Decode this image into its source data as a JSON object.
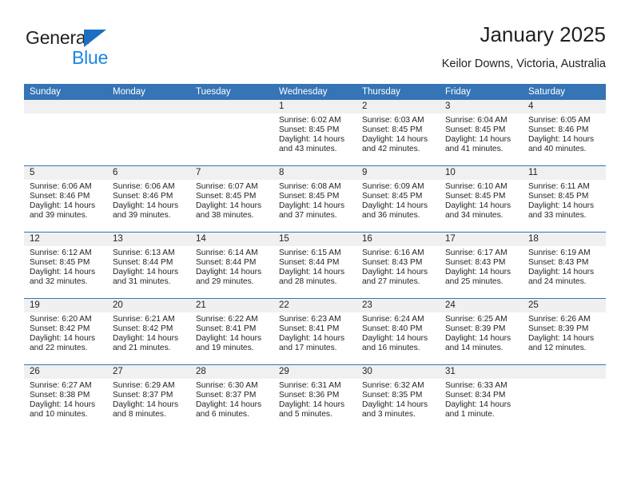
{
  "brand": {
    "name_part1": "General",
    "name_part2": "Blue",
    "triangle_color": "#1b6fc1",
    "blue_text_color": "#1b86e0"
  },
  "header": {
    "title": "January 2025",
    "subtitle": "Keilor Downs, Victoria, Australia",
    "header_bg_color": "#3574b5",
    "daynum_band_color": "#f0f0f0"
  },
  "weekday_headers": [
    "Sunday",
    "Monday",
    "Tuesday",
    "Wednesday",
    "Thursday",
    "Friday",
    "Saturday"
  ],
  "weeks": [
    [
      {
        "day": "",
        "sunrise": "",
        "sunset": "",
        "daylight_line1": "",
        "daylight_line2": ""
      },
      {
        "day": "",
        "sunrise": "",
        "sunset": "",
        "daylight_line1": "",
        "daylight_line2": ""
      },
      {
        "day": "",
        "sunrise": "",
        "sunset": "",
        "daylight_line1": "",
        "daylight_line2": ""
      },
      {
        "day": "1",
        "sunrise": "Sunrise: 6:02 AM",
        "sunset": "Sunset: 8:45 PM",
        "daylight_line1": "Daylight: 14 hours",
        "daylight_line2": "and 43 minutes."
      },
      {
        "day": "2",
        "sunrise": "Sunrise: 6:03 AM",
        "sunset": "Sunset: 8:45 PM",
        "daylight_line1": "Daylight: 14 hours",
        "daylight_line2": "and 42 minutes."
      },
      {
        "day": "3",
        "sunrise": "Sunrise: 6:04 AM",
        "sunset": "Sunset: 8:45 PM",
        "daylight_line1": "Daylight: 14 hours",
        "daylight_line2": "and 41 minutes."
      },
      {
        "day": "4",
        "sunrise": "Sunrise: 6:05 AM",
        "sunset": "Sunset: 8:46 PM",
        "daylight_line1": "Daylight: 14 hours",
        "daylight_line2": "and 40 minutes."
      }
    ],
    [
      {
        "day": "5",
        "sunrise": "Sunrise: 6:06 AM",
        "sunset": "Sunset: 8:46 PM",
        "daylight_line1": "Daylight: 14 hours",
        "daylight_line2": "and 39 minutes."
      },
      {
        "day": "6",
        "sunrise": "Sunrise: 6:06 AM",
        "sunset": "Sunset: 8:46 PM",
        "daylight_line1": "Daylight: 14 hours",
        "daylight_line2": "and 39 minutes."
      },
      {
        "day": "7",
        "sunrise": "Sunrise: 6:07 AM",
        "sunset": "Sunset: 8:45 PM",
        "daylight_line1": "Daylight: 14 hours",
        "daylight_line2": "and 38 minutes."
      },
      {
        "day": "8",
        "sunrise": "Sunrise: 6:08 AM",
        "sunset": "Sunset: 8:45 PM",
        "daylight_line1": "Daylight: 14 hours",
        "daylight_line2": "and 37 minutes."
      },
      {
        "day": "9",
        "sunrise": "Sunrise: 6:09 AM",
        "sunset": "Sunset: 8:45 PM",
        "daylight_line1": "Daylight: 14 hours",
        "daylight_line2": "and 36 minutes."
      },
      {
        "day": "10",
        "sunrise": "Sunrise: 6:10 AM",
        "sunset": "Sunset: 8:45 PM",
        "daylight_line1": "Daylight: 14 hours",
        "daylight_line2": "and 34 minutes."
      },
      {
        "day": "11",
        "sunrise": "Sunrise: 6:11 AM",
        "sunset": "Sunset: 8:45 PM",
        "daylight_line1": "Daylight: 14 hours",
        "daylight_line2": "and 33 minutes."
      }
    ],
    [
      {
        "day": "12",
        "sunrise": "Sunrise: 6:12 AM",
        "sunset": "Sunset: 8:45 PM",
        "daylight_line1": "Daylight: 14 hours",
        "daylight_line2": "and 32 minutes."
      },
      {
        "day": "13",
        "sunrise": "Sunrise: 6:13 AM",
        "sunset": "Sunset: 8:44 PM",
        "daylight_line1": "Daylight: 14 hours",
        "daylight_line2": "and 31 minutes."
      },
      {
        "day": "14",
        "sunrise": "Sunrise: 6:14 AM",
        "sunset": "Sunset: 8:44 PM",
        "daylight_line1": "Daylight: 14 hours",
        "daylight_line2": "and 29 minutes."
      },
      {
        "day": "15",
        "sunrise": "Sunrise: 6:15 AM",
        "sunset": "Sunset: 8:44 PM",
        "daylight_line1": "Daylight: 14 hours",
        "daylight_line2": "and 28 minutes."
      },
      {
        "day": "16",
        "sunrise": "Sunrise: 6:16 AM",
        "sunset": "Sunset: 8:43 PM",
        "daylight_line1": "Daylight: 14 hours",
        "daylight_line2": "and 27 minutes."
      },
      {
        "day": "17",
        "sunrise": "Sunrise: 6:17 AM",
        "sunset": "Sunset: 8:43 PM",
        "daylight_line1": "Daylight: 14 hours",
        "daylight_line2": "and 25 minutes."
      },
      {
        "day": "18",
        "sunrise": "Sunrise: 6:19 AM",
        "sunset": "Sunset: 8:43 PM",
        "daylight_line1": "Daylight: 14 hours",
        "daylight_line2": "and 24 minutes."
      }
    ],
    [
      {
        "day": "19",
        "sunrise": "Sunrise: 6:20 AM",
        "sunset": "Sunset: 8:42 PM",
        "daylight_line1": "Daylight: 14 hours",
        "daylight_line2": "and 22 minutes."
      },
      {
        "day": "20",
        "sunrise": "Sunrise: 6:21 AM",
        "sunset": "Sunset: 8:42 PM",
        "daylight_line1": "Daylight: 14 hours",
        "daylight_line2": "and 21 minutes."
      },
      {
        "day": "21",
        "sunrise": "Sunrise: 6:22 AM",
        "sunset": "Sunset: 8:41 PM",
        "daylight_line1": "Daylight: 14 hours",
        "daylight_line2": "and 19 minutes."
      },
      {
        "day": "22",
        "sunrise": "Sunrise: 6:23 AM",
        "sunset": "Sunset: 8:41 PM",
        "daylight_line1": "Daylight: 14 hours",
        "daylight_line2": "and 17 minutes."
      },
      {
        "day": "23",
        "sunrise": "Sunrise: 6:24 AM",
        "sunset": "Sunset: 8:40 PM",
        "daylight_line1": "Daylight: 14 hours",
        "daylight_line2": "and 16 minutes."
      },
      {
        "day": "24",
        "sunrise": "Sunrise: 6:25 AM",
        "sunset": "Sunset: 8:39 PM",
        "daylight_line1": "Daylight: 14 hours",
        "daylight_line2": "and 14 minutes."
      },
      {
        "day": "25",
        "sunrise": "Sunrise: 6:26 AM",
        "sunset": "Sunset: 8:39 PM",
        "daylight_line1": "Daylight: 14 hours",
        "daylight_line2": "and 12 minutes."
      }
    ],
    [
      {
        "day": "26",
        "sunrise": "Sunrise: 6:27 AM",
        "sunset": "Sunset: 8:38 PM",
        "daylight_line1": "Daylight: 14 hours",
        "daylight_line2": "and 10 minutes."
      },
      {
        "day": "27",
        "sunrise": "Sunrise: 6:29 AM",
        "sunset": "Sunset: 8:37 PM",
        "daylight_line1": "Daylight: 14 hours",
        "daylight_line2": "and 8 minutes."
      },
      {
        "day": "28",
        "sunrise": "Sunrise: 6:30 AM",
        "sunset": "Sunset: 8:37 PM",
        "daylight_line1": "Daylight: 14 hours",
        "daylight_line2": "and 6 minutes."
      },
      {
        "day": "29",
        "sunrise": "Sunrise: 6:31 AM",
        "sunset": "Sunset: 8:36 PM",
        "daylight_line1": "Daylight: 14 hours",
        "daylight_line2": "and 5 minutes."
      },
      {
        "day": "30",
        "sunrise": "Sunrise: 6:32 AM",
        "sunset": "Sunset: 8:35 PM",
        "daylight_line1": "Daylight: 14 hours",
        "daylight_line2": "and 3 minutes."
      },
      {
        "day": "31",
        "sunrise": "Sunrise: 6:33 AM",
        "sunset": "Sunset: 8:34 PM",
        "daylight_line1": "Daylight: 14 hours",
        "daylight_line2": "and 1 minute."
      },
      {
        "day": "",
        "sunrise": "",
        "sunset": "",
        "daylight_line1": "",
        "daylight_line2": ""
      }
    ]
  ]
}
